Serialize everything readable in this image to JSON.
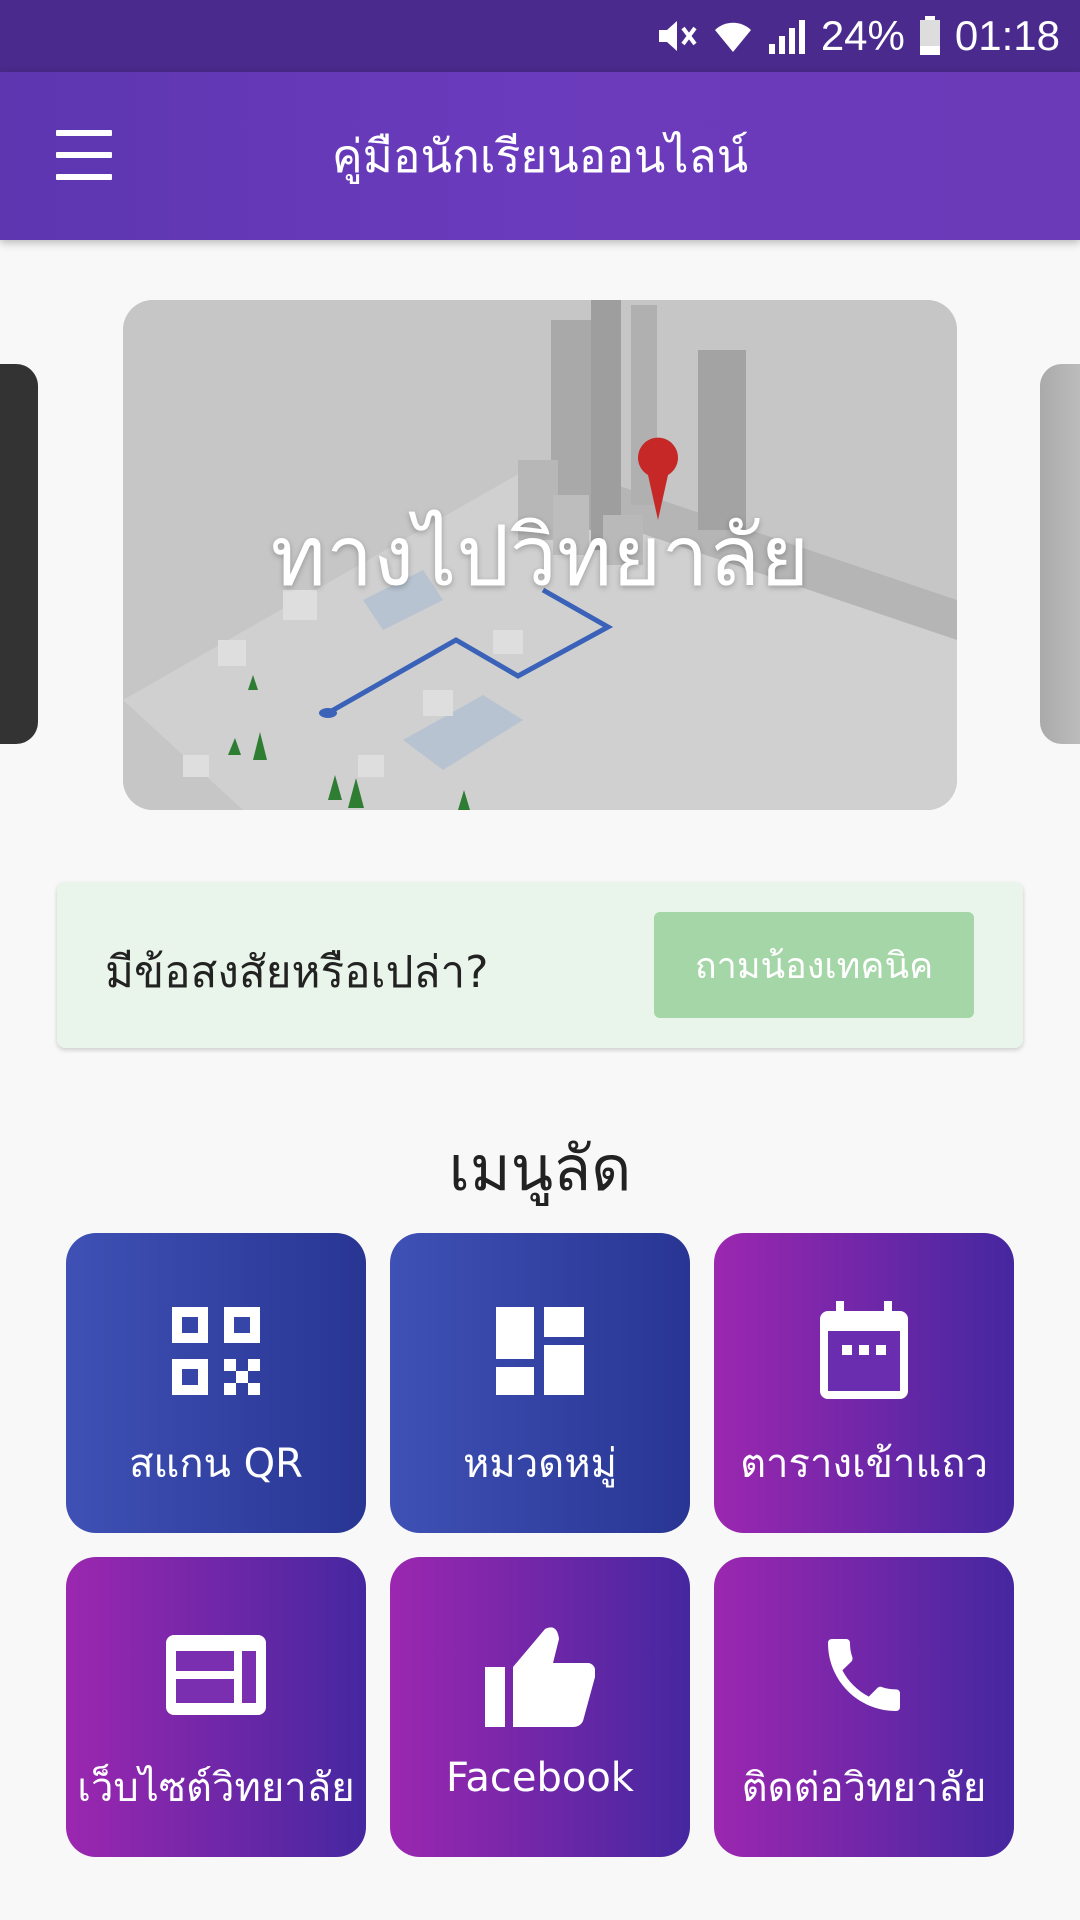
{
  "status_bar": {
    "battery": "24%",
    "time": "01:18"
  },
  "app_bar": {
    "title": "คู่มือนักเรียนออนไลน์"
  },
  "banner": {
    "title": "ทางไปวิทยาลัย"
  },
  "help": {
    "text": "มีข้อสงสัยหรือเปล่า?",
    "button": "ถามน้องเทคนิค"
  },
  "shortcuts": {
    "title": "เมนูลัด",
    "items": [
      {
        "label": "สแกน QR",
        "icon": "qr-code-icon"
      },
      {
        "label": "หมวดหมู่",
        "icon": "dashboard-icon"
      },
      {
        "label": "ตารางเข้าแถว",
        "icon": "calendar-icon"
      },
      {
        "label": "เว็บไซต์วิทยาลัย",
        "icon": "web-icon"
      },
      {
        "label": "Facebook",
        "icon": "thumb-up-icon"
      },
      {
        "label": "ติดต่อวิทยาลัย",
        "icon": "phone-icon"
      }
    ]
  },
  "colors": {
    "status_bar": "#4a2a8c",
    "app_bar": "#6a3ab8",
    "tile_blue": "#3f51b5",
    "tile_purple": "#9c27b0",
    "help_button": "#a5d6a7"
  }
}
